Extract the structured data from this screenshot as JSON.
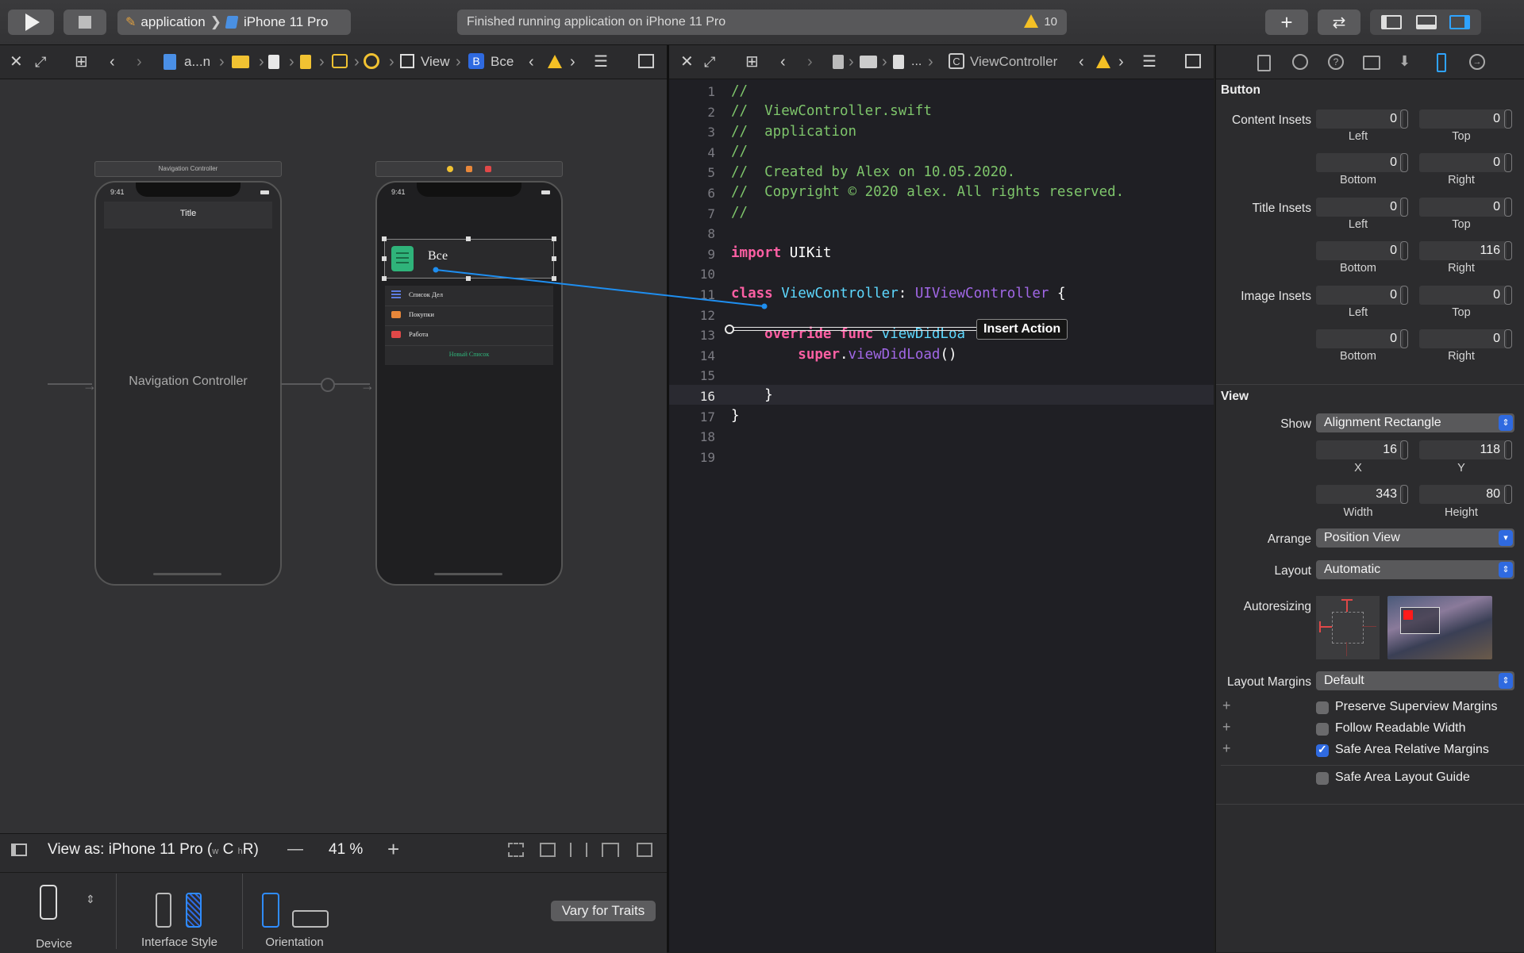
{
  "toolbar": {
    "scheme_app": "application",
    "scheme_device": "iPhone 11 Pro",
    "status_text": "Finished running application on iPhone 11 Pro",
    "warning_count": "10"
  },
  "storyboard_jumpbar": {
    "file_short": "a...n",
    "crumb_view": "View",
    "crumb_button_badge": "B",
    "crumb_button": "Все"
  },
  "editor_jumpbar": {
    "ellipsis": "...",
    "class_badge": "C",
    "class_name": "ViewController"
  },
  "canvas": {
    "nav_scene_title": "Navigation Controller",
    "nav_label": "Navigation Controller",
    "nav_bar_title": "Title",
    "status_time_1": "9:41",
    "status_time_2": "9:41",
    "header_button_label": "Все",
    "list_items": [
      {
        "label": "Список Дел",
        "icon": "list-icon",
        "color": "#5e7ce0"
      },
      {
        "label": "Покупки",
        "icon": "cart-icon",
        "color": "#e8873a"
      },
      {
        "label": "Работа",
        "icon": "briefcase-icon",
        "color": "#e04848"
      }
    ],
    "new_list_label": "Новый Список"
  },
  "code": {
    "line_numbers": [
      "1",
      "2",
      "3",
      "4",
      "5",
      "6",
      "7",
      "8",
      "9",
      "10",
      "11",
      "12",
      "13",
      "14",
      "15",
      "16",
      "17",
      "18",
      "19"
    ],
    "current_line": "16",
    "l1": "//",
    "l2": "//  ViewController.swift",
    "l3": "//  application",
    "l4": "//",
    "l5": "//  Created by Alex on 10.05.2020.",
    "l6": "//  Copyright © 2020 alex. All rights reserved.",
    "l7": "//",
    "l9_kw": "import",
    "l9_rest": " UIKit",
    "l11_kw": "class",
    "l11_type": "ViewController",
    "l11_colon": ": ",
    "l11_super": "UIViewController",
    "l11_brace": " {",
    "l13_kw": "override func",
    "l13_fn": "viewDidLoa",
    "l14_kw": "super",
    "l14_dot": ".",
    "l14_fn": "viewDidLoad",
    "l14_rest": "()",
    "l16": "}",
    "l17": "}",
    "insert_action": "Insert Action"
  },
  "inspector": {
    "button_section": "Button",
    "content_insets": "Content Insets",
    "title_insets": "Title Insets",
    "image_insets": "Image Insets",
    "lbl_left": "Left",
    "lbl_top": "Top",
    "lbl_bottom": "Bottom",
    "lbl_right": "Right",
    "content": {
      "left": "0",
      "top": "0",
      "bottom": "0",
      "right": "0"
    },
    "title": {
      "left": "0",
      "top": "0",
      "bottom": "0",
      "right": "116"
    },
    "image": {
      "left": "0",
      "top": "0",
      "bottom": "0",
      "right": "0"
    },
    "view_section": "View",
    "show_label": "Show",
    "show_value": "Alignment Rectangle",
    "x_value": "16",
    "y_value": "118",
    "x_label": "X",
    "y_label": "Y",
    "width_value": "343",
    "height_value": "80",
    "width_label": "Width",
    "height_label": "Height",
    "arrange_label": "Arrange",
    "arrange_value": "Position View",
    "layout_label": "Layout",
    "layout_value": "Automatic",
    "autoresizing_label": "Autoresizing",
    "layout_margins_label": "Layout Margins",
    "layout_margins_value": "Default",
    "preserve_label": "Preserve Superview Margins",
    "preserve_checked": false,
    "readable_label": "Follow Readable Width",
    "readable_checked": false,
    "safe_rel_label": "Safe Area Relative Margins",
    "safe_rel_checked": true,
    "safe_guide_label": "Safe Area Layout Guide",
    "safe_guide_checked": false,
    "plus": "+"
  },
  "bottombar": {
    "view_as": "View as: iPhone 11 Pro (",
    "trait_w": "w",
    "trait_c": "C",
    "trait_h": "h",
    "trait_r": "R)",
    "minus": "—",
    "zoom": "41 %",
    "plus": "+",
    "vary": "Vary for Traits",
    "device_label": "Device",
    "style_label": "Interface Style",
    "orientation_label": "Orientation"
  },
  "colors": {
    "accent": "#2f6ae0",
    "selection": "#1e8ef0",
    "warning": "#f4c025",
    "app_green": "#2fb37a"
  }
}
